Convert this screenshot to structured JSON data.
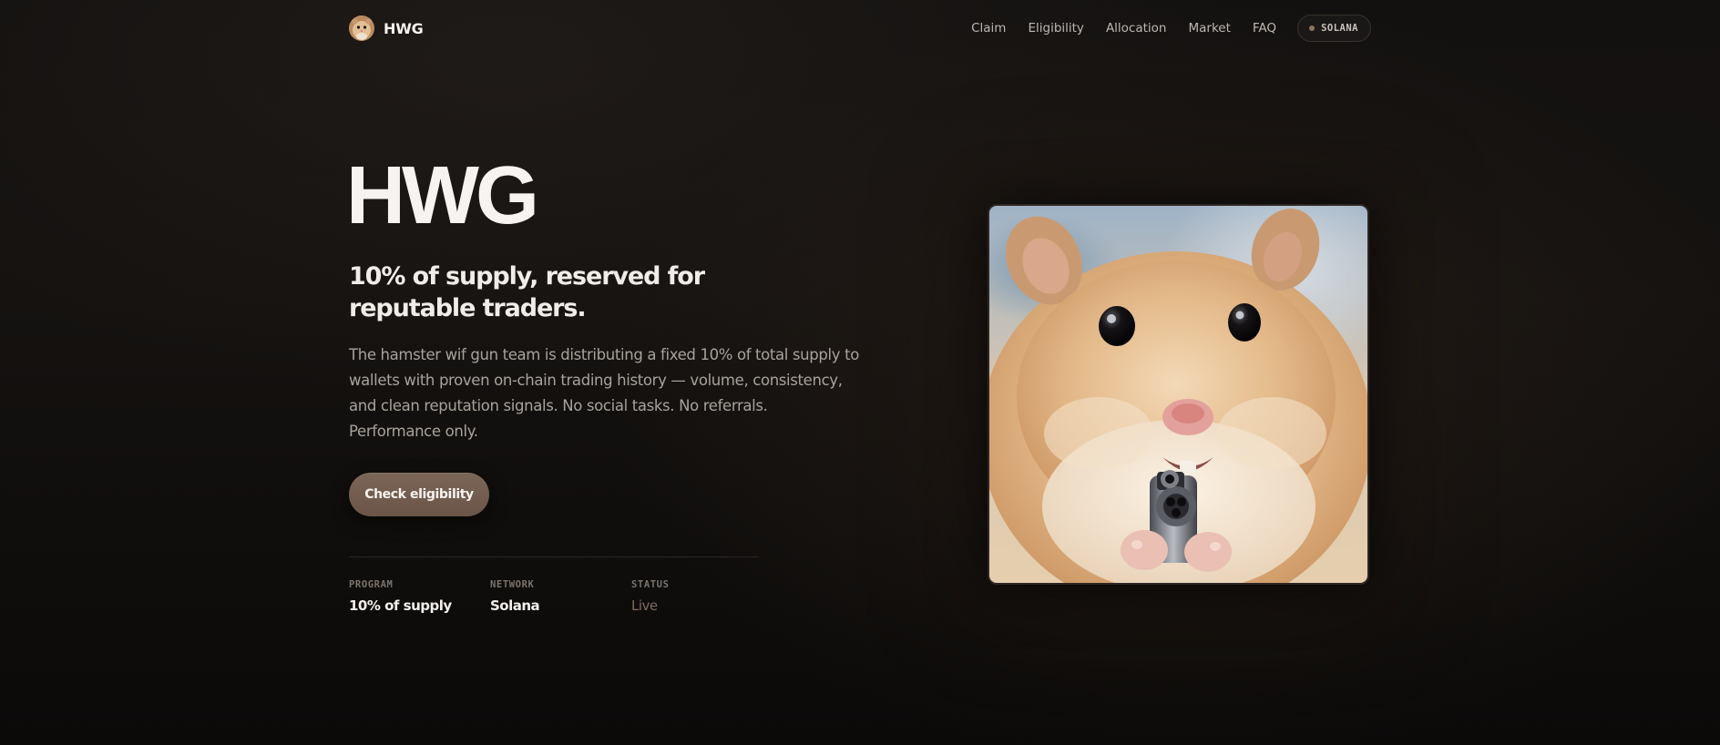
{
  "nav": {
    "brand_name": "HWG",
    "brand_avatar_icon": "hamster-avatar-icon",
    "links": [
      "Claim",
      "Eligibility",
      "Allocation",
      "Market",
      "FAQ"
    ],
    "network_pill": "SOLANA"
  },
  "hero": {
    "title": "HWG",
    "subtitle": "10% of supply, reserved for reputable traders.",
    "description": "The hamster wif gun team is distributing a fixed 10% of total supply to wallets with proven on-chain trading history — volume, consistency, and clean reputation signals. No social tasks. No referrals. Performance only.",
    "cta_label": "Check eligibility",
    "image_icon": "hamster-with-gun-image"
  },
  "stats": [
    {
      "label": "PROGRAM",
      "value": "10% of supply"
    },
    {
      "label": "NETWORK",
      "value": "Solana"
    },
    {
      "label": "STATUS",
      "value": "Live"
    }
  ],
  "colors": {
    "background": "#131110",
    "accent": "#7b6658",
    "status_live": "#7c6b5f"
  }
}
